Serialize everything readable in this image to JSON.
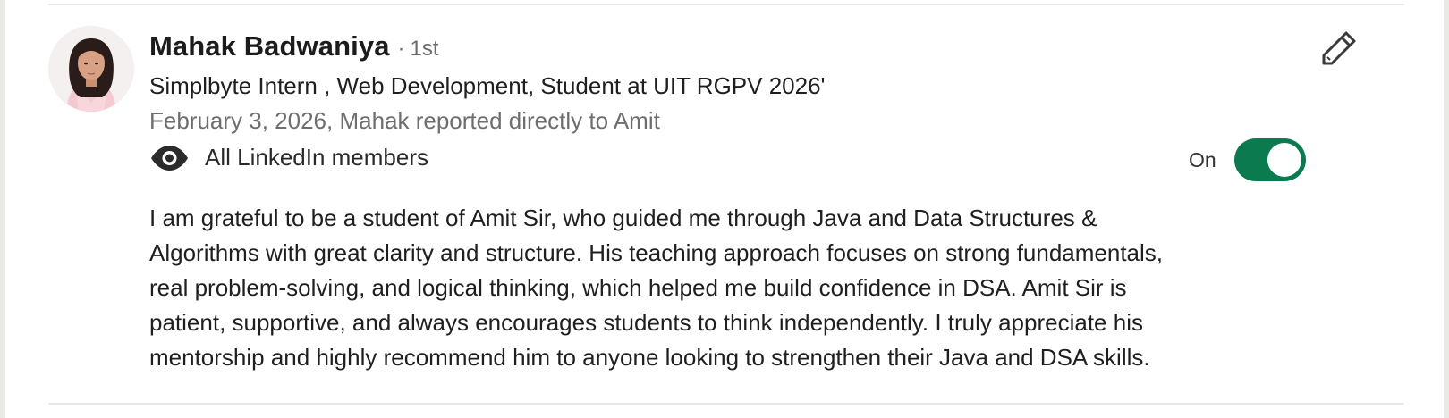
{
  "recommendation": {
    "name": "Mahak Badwaniya",
    "separator": "·",
    "degree": "1st",
    "headline": "Simplbyte Intern , Web Development, Student at UIT RGPV 2026'",
    "meta": "February 3, 2026, Mahak reported directly to Amit",
    "visibility": {
      "icon": "eye-icon",
      "label": "All LinkedIn members"
    },
    "toggle": {
      "label": "On",
      "state": true,
      "color": "#0b7a4f"
    },
    "edit": {
      "icon": "pencil-icon"
    },
    "text_lines": [
      "I am grateful to be a student of Amit Sir, who guided me through Java and Data Structures &",
      "Algorithms with great clarity and structure. His teaching approach focuses on strong fundamentals,",
      "real problem-solving, and logical thinking, which helped me build confidence in DSA. Amit Sir is",
      "patient, supportive, and always encourages students to think independently. I truly appreciate his",
      "mentorship and highly recommend him to anyone looking to strengthen their Java and DSA skills."
    ]
  }
}
